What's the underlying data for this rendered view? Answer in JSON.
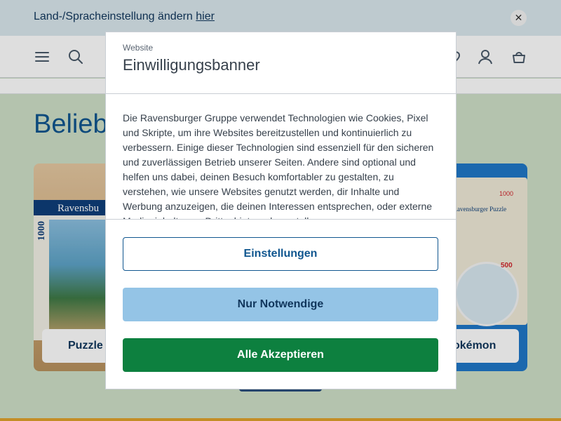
{
  "locale_bar": {
    "text": "Land-/Spracheinstellung ändern ",
    "link": "hier",
    "close_icon": "close-icon"
  },
  "header": {
    "icons": [
      "menu-icon",
      "search-icon",
      "wishlist-icon",
      "account-icon",
      "cart-icon"
    ]
  },
  "page": {
    "section_title": "Beliebt",
    "cards": [
      {
        "label": "Puzzle",
        "box_brand": "Ravensbu",
        "box_number": "1000"
      },
      {
        "label": "okémon",
        "box_brand": "Ravensburger Puzzle",
        "box_number": "500",
        "box_number_top": "1000"
      }
    ]
  },
  "modal": {
    "subtitle": "Website",
    "title": "Einwilligungsbanner",
    "body": "Die Ravensburger Gruppe verwendet Technologien wie Cookies, Pixel und Skripte, um ihre Websites bereitzustellen und kontinuierlich zu verbessern. Einige dieser Technologien sind essenziell für den sicheren und zuverlässigen Betrieb unserer Seiten. Andere sind optional und helfen uns dabei, deinen Besuch komfortabler zu gestalten, zu verstehen, wie unsere Websites genutzt werden, dir Inhalte und Werbung anzuzeigen, die deinen Interessen entsprechen, oder externe Medieninhalte von Drittanbietern darzustellen.",
    "buttons": {
      "settings": "Einstellungen",
      "necessary": "Nur Notwendige",
      "accept": "Alle Akzeptieren"
    }
  },
  "colors": {
    "accent_blue": "#10568f",
    "accept_green": "#0d803f",
    "necessary_light_blue": "#94c4e6",
    "footer_gold": "#e0a32c"
  }
}
